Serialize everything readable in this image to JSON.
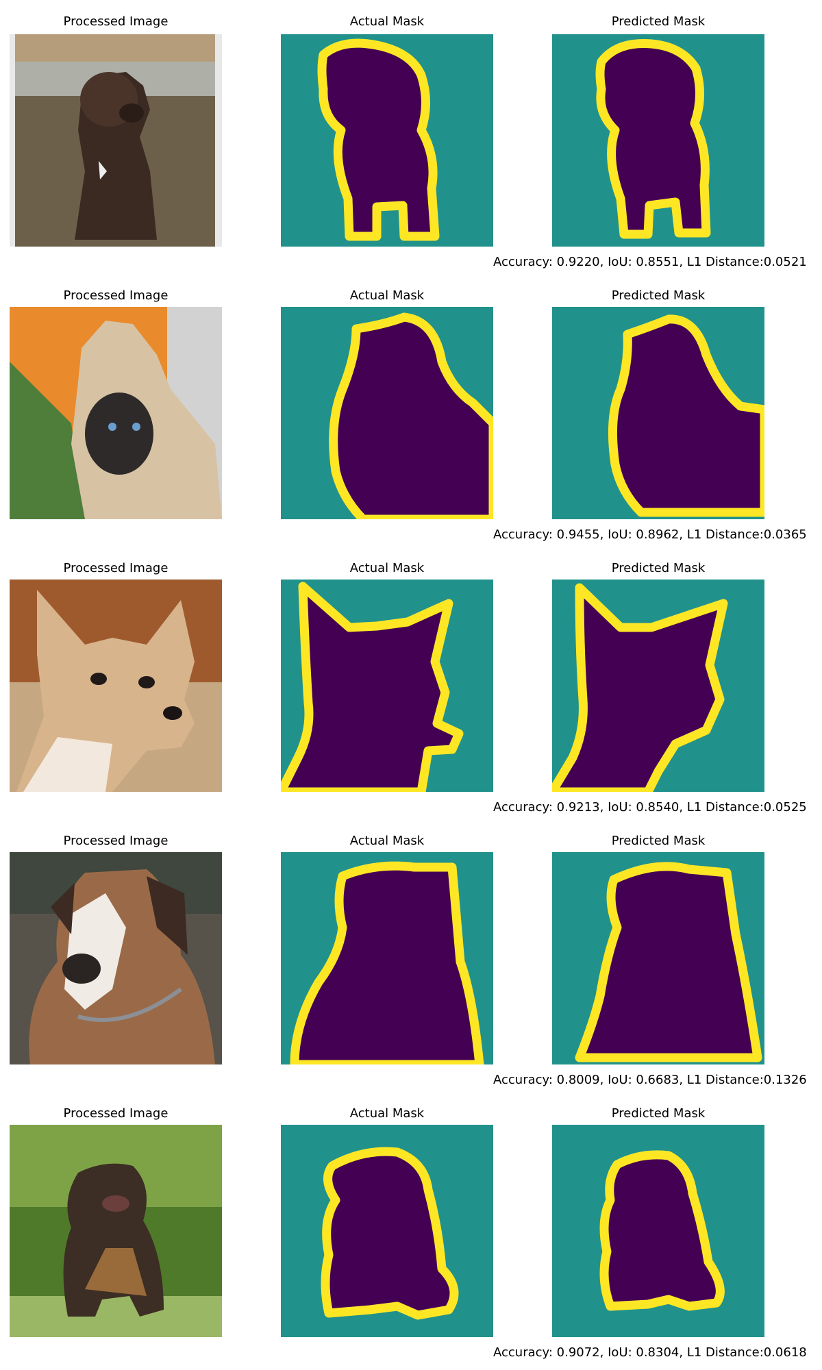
{
  "colors": {
    "mask_background": "#21918c",
    "mask_foreground": "#440154",
    "mask_boundary": "#fde725"
  },
  "rows": [
    {
      "image_title": "Processed Image",
      "actual_title": "Actual Mask",
      "predicted_title": "Predicted Mask",
      "metrics": "Accuracy: 0.9220, IoU: 0.8551, L1 Distance:0.0521",
      "image_subject": "brown puppy sitting on ground"
    },
    {
      "image_title": "Processed Image",
      "actual_title": "Actual Mask",
      "predicted_title": "Predicted Mask",
      "metrics": "Accuracy: 0.9455, IoU: 0.8962, L1 Distance:0.0365",
      "image_subject": "siamese cat with orange background"
    },
    {
      "image_title": "Processed Image",
      "actual_title": "Actual Mask",
      "predicted_title": "Predicted Mask",
      "metrics": "Accuracy: 0.9213, IoU: 0.8540, L1 Distance:0.0525",
      "image_subject": "chihuahua head close-up"
    },
    {
      "image_title": "Processed Image",
      "actual_title": "Actual Mask",
      "predicted_title": "Predicted Mask",
      "metrics": "Accuracy: 0.8009, IoU: 0.6683, L1 Distance:0.1326",
      "image_subject": "boxer dog with collar"
    },
    {
      "image_title": "Processed Image",
      "actual_title": "Actual Mask",
      "predicted_title": "Predicted Mask",
      "metrics": "Accuracy: 0.9072, IoU: 0.8304, L1 Distance:0.0618",
      "image_subject": "fluffy dog sitting on grass"
    }
  ]
}
